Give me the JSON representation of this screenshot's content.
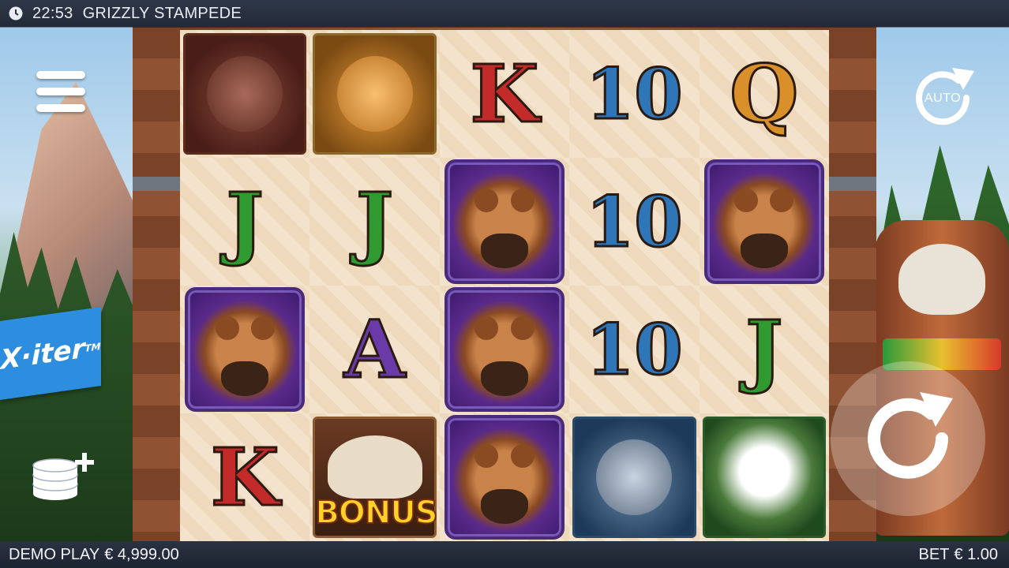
{
  "header": {
    "time": "22:53",
    "title": "GRIZZLY STAMPEDE"
  },
  "footer": {
    "mode_label": "DEMO PLAY",
    "balance": "€ 4,999.00",
    "bet_label": "BET",
    "bet_value": "€ 1.00"
  },
  "controls": {
    "auto_label": "AUTO",
    "brand": "X·iter",
    "brand_tm": "TM"
  },
  "reels": [
    [
      "moose",
      "J",
      "grizzly-bear",
      "K"
    ],
    [
      "cougar",
      "J",
      "A",
      "bonus-skull"
    ],
    [
      "K",
      "grizzly-bear",
      "grizzly-bear",
      "grizzly-bear"
    ],
    [
      "10",
      "10",
      "10",
      "wolf"
    ],
    [
      "Q",
      "grizzly-bear",
      "J",
      "eagle"
    ]
  ],
  "symbols": {
    "k": "K",
    "j": "J",
    "a": "A",
    "q": "Q",
    "ten": "10",
    "bonus_label": "BONUS"
  },
  "colors": {
    "k": "#c32a2a",
    "j": "#2f9a2f",
    "a": "#6a3aa8",
    "q": "#d9902a",
    "ten": "#2f76b8",
    "bonus": "#ffd22a",
    "brand": "#2d8ee0"
  }
}
